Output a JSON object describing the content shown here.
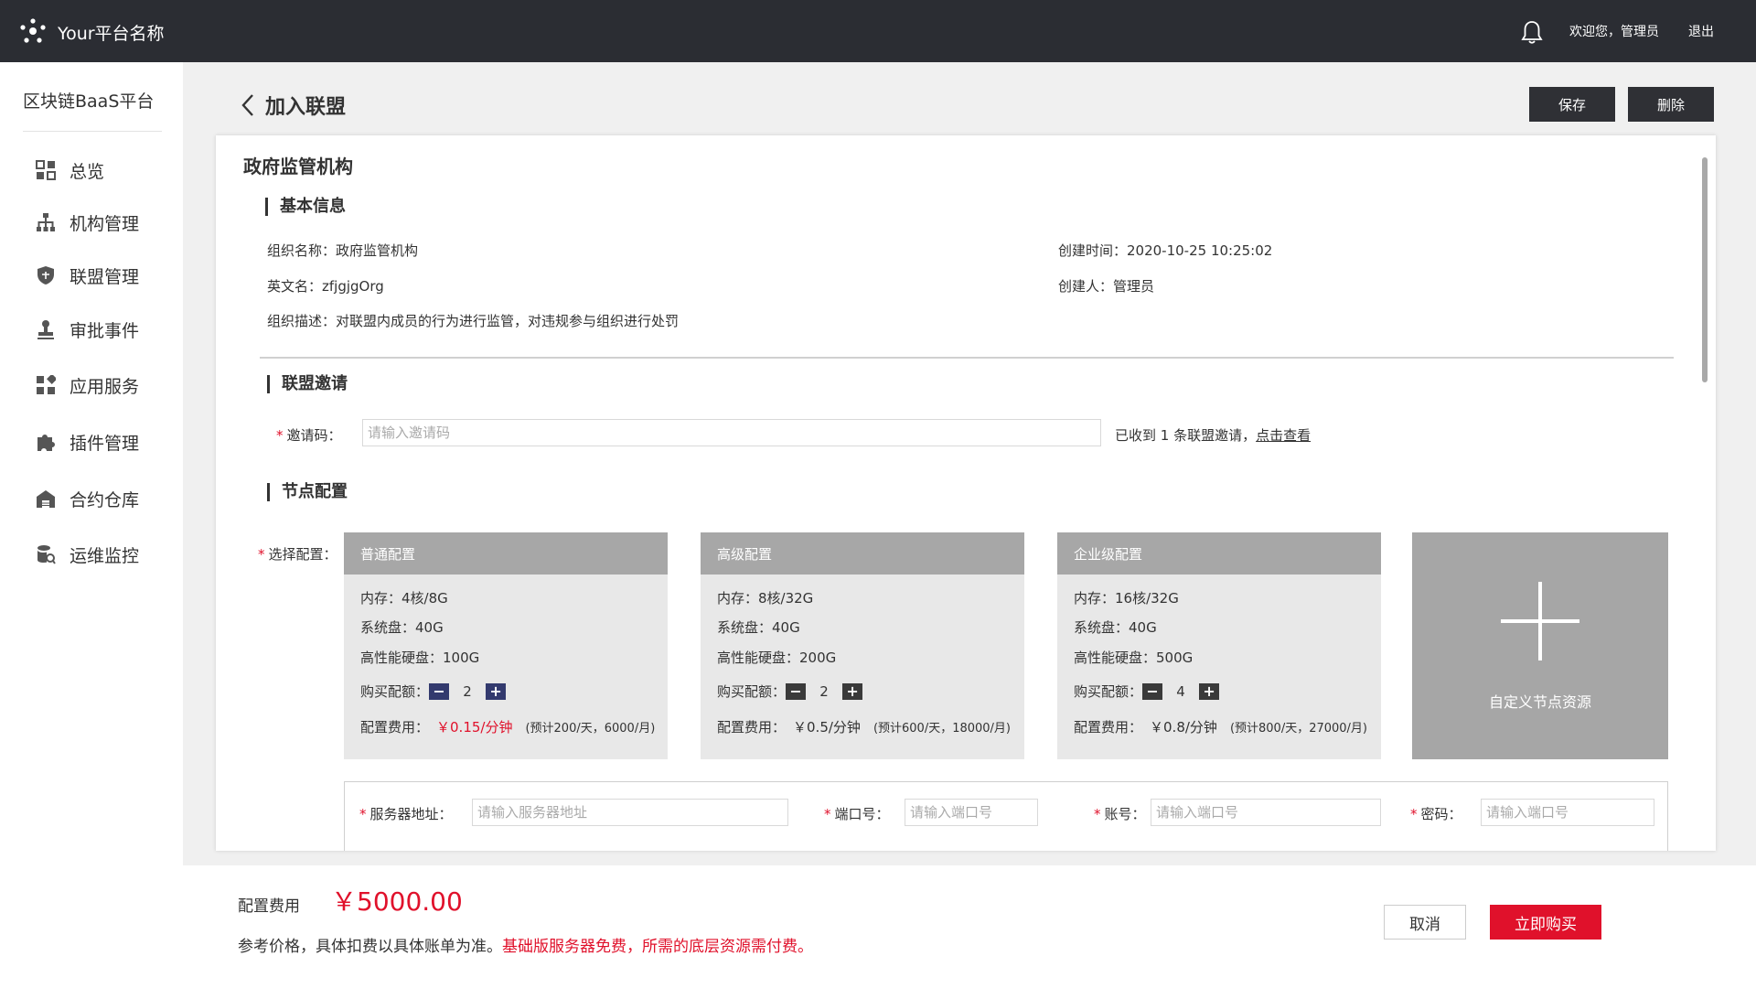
{
  "header": {
    "platform_name": "Your平台名称",
    "welcome": "欢迎您，管理员",
    "logout": "退出"
  },
  "sidebar": {
    "title": "区块链BaaS平台",
    "items": [
      {
        "label": "总览",
        "icon": "dashboard-icon"
      },
      {
        "label": "机构管理",
        "icon": "org-tree-icon"
      },
      {
        "label": "联盟管理",
        "icon": "alliance-shield-icon"
      },
      {
        "label": "审批事件",
        "icon": "stamp-icon"
      },
      {
        "label": "应用服务",
        "icon": "app-grid-icon"
      },
      {
        "label": "插件管理",
        "icon": "puzzle-icon"
      },
      {
        "label": "合约仓库",
        "icon": "warehouse-icon"
      },
      {
        "label": "运维监控",
        "icon": "database-monitor-icon"
      }
    ]
  },
  "page": {
    "title": "加入联盟",
    "save_label": "保存",
    "delete_label": "删除"
  },
  "org": {
    "title": "政府监管机构",
    "basic_section": "基本信息",
    "name": "组织名称：政府监管机构",
    "en_name": "英文名：zfjgjgOrg",
    "description": "组织描述：对联盟内成员的行为进行监管，对违规参与组织进行处罚",
    "created_at": "创建时间：2020-10-25 10:25:02",
    "creator": "创建人：管理员"
  },
  "invite": {
    "section": "联盟邀请",
    "label": "邀请码：",
    "placeholder": "请输入邀请码",
    "note": "已收到 1 条联盟邀请，",
    "link": "点击查看"
  },
  "node_config": {
    "section": "节点配置",
    "select_label": "选择配置：",
    "cards": [
      {
        "title": "普通配置",
        "memory": "内存：4核/8G",
        "system_disk": "系统盘：40G",
        "hp_disk": "高性能硬盘：100G",
        "quota_label": "购买配额：",
        "quota": "2",
        "cost_label": "配置费用：",
        "price": "￥0.15/分钟",
        "estimate": "(预计200/天，6000/月)"
      },
      {
        "title": "高级配置",
        "memory": "内存：8核/32G",
        "system_disk": "系统盘：40G",
        "hp_disk": "高性能硬盘：200G",
        "quota_label": "购买配额：",
        "quota": "2",
        "cost_label": "配置费用：",
        "price": "￥0.5/分钟",
        "estimate": "(预计600/天，18000/月)"
      },
      {
        "title": "企业级配置",
        "memory": "内存：16核/32G",
        "system_disk": "系统盘：40G",
        "hp_disk": "高性能硬盘：500G",
        "quota_label": "购买配额：",
        "quota": "4",
        "cost_label": "配置费用：",
        "price": "￥0.8/分钟",
        "estimate": "(预计800/天，27000/月)"
      }
    ],
    "custom_label": "自定义节点资源"
  },
  "server": {
    "address_label": "服务器地址：",
    "address_placeholder": "请输入服务器地址",
    "port_label": "端口号：",
    "port_placeholder": "请输入端口号",
    "account_label": "账号：",
    "account_placeholder": "请输入端口号",
    "password_label": "密码：",
    "password_placeholder": "请输入端口号"
  },
  "footer": {
    "fee_label": "配置费用",
    "fee_value": "￥5000.00",
    "note": "参考价格，具体扣费以具体账单为准。",
    "note_red": "基础版服务器免费，所需的底层资源需付费。",
    "cancel": "取消",
    "buy": "立即购买"
  },
  "colors": {
    "topbar": "#2b2d33",
    "accent_red": "#e0112b",
    "card_header": "#a7a7a7",
    "stepper_blue": "#333a6e"
  }
}
